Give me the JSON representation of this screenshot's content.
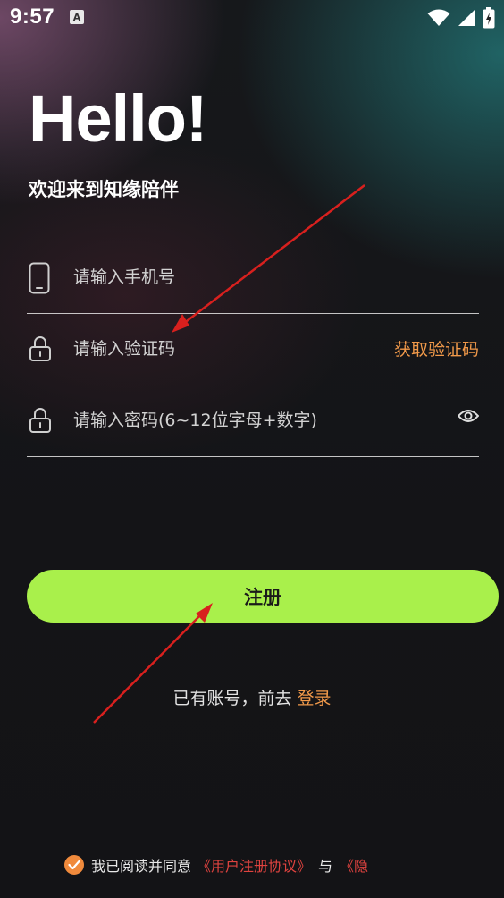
{
  "status_bar": {
    "time": "9:57",
    "notification_glyph": "A"
  },
  "header": {
    "greeting": "Hello!",
    "welcome": "欢迎来到知缘陪伴"
  },
  "form": {
    "phone": {
      "placeholder": "请输入手机号",
      "value": ""
    },
    "code": {
      "placeholder": "请输入验证码",
      "value": "",
      "get_code_label": "获取验证码"
    },
    "password": {
      "placeholder": "请输入密码(6~12位字母+数字)",
      "value": ""
    }
  },
  "actions": {
    "register_label": "注册",
    "has_account_text": "已有账号，前去 ",
    "login_label": "登录"
  },
  "agreement": {
    "prefix": "我已阅读并同意",
    "user_agreement": "《用户注册协议》",
    "conjunction": "与",
    "privacy_policy": "《隐"
  },
  "colors": {
    "accent_green": "#a9f04b",
    "accent_orange": "#f29a4a",
    "link_red": "#e0433f"
  },
  "icons": {
    "phone": "smartphone-icon",
    "lock": "lock-icon",
    "eye": "eye-icon",
    "check": "check-icon"
  }
}
